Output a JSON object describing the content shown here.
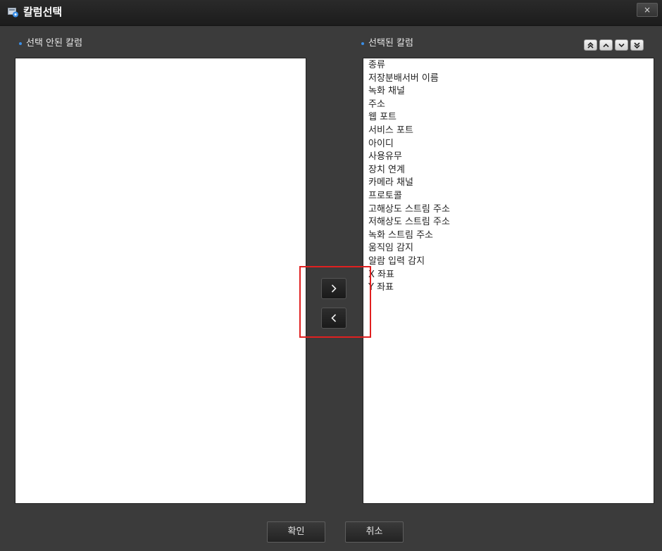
{
  "window": {
    "title": "칼럼선택",
    "close_label": "×"
  },
  "left_panel": {
    "label": "선택 안된 칼럼",
    "items": []
  },
  "right_panel": {
    "label": "선택된 칼럼",
    "items": [
      "종류",
      "저장분배서버 이름",
      "녹화 채널",
      "주소",
      "웹 포트",
      "서비스 포트",
      "아이디",
      "사용유무",
      "장치 연계",
      "카메라 채널",
      "프로토콜",
      "고해상도 스트림 주소",
      "저해상도 스트림 주소",
      "녹화 스트림 주소",
      "움직임 감지",
      "알람 입력 감지",
      "X 좌표",
      "Y 좌표"
    ]
  },
  "order_buttons": [
    {
      "name": "move-top-button",
      "icon": "double-chevron-up-icon"
    },
    {
      "name": "move-up-button",
      "icon": "chevron-up-icon"
    },
    {
      "name": "move-down-button",
      "icon": "chevron-down-icon"
    },
    {
      "name": "move-bottom-button",
      "icon": "double-chevron-down-icon"
    }
  ],
  "transfer_buttons": {
    "add_label": ">",
    "remove_label": "<"
  },
  "footer": {
    "ok_label": "확인",
    "cancel_label": "취소"
  },
  "colors": {
    "bullet": "#3a8ee6",
    "highlight": "#e02020"
  }
}
